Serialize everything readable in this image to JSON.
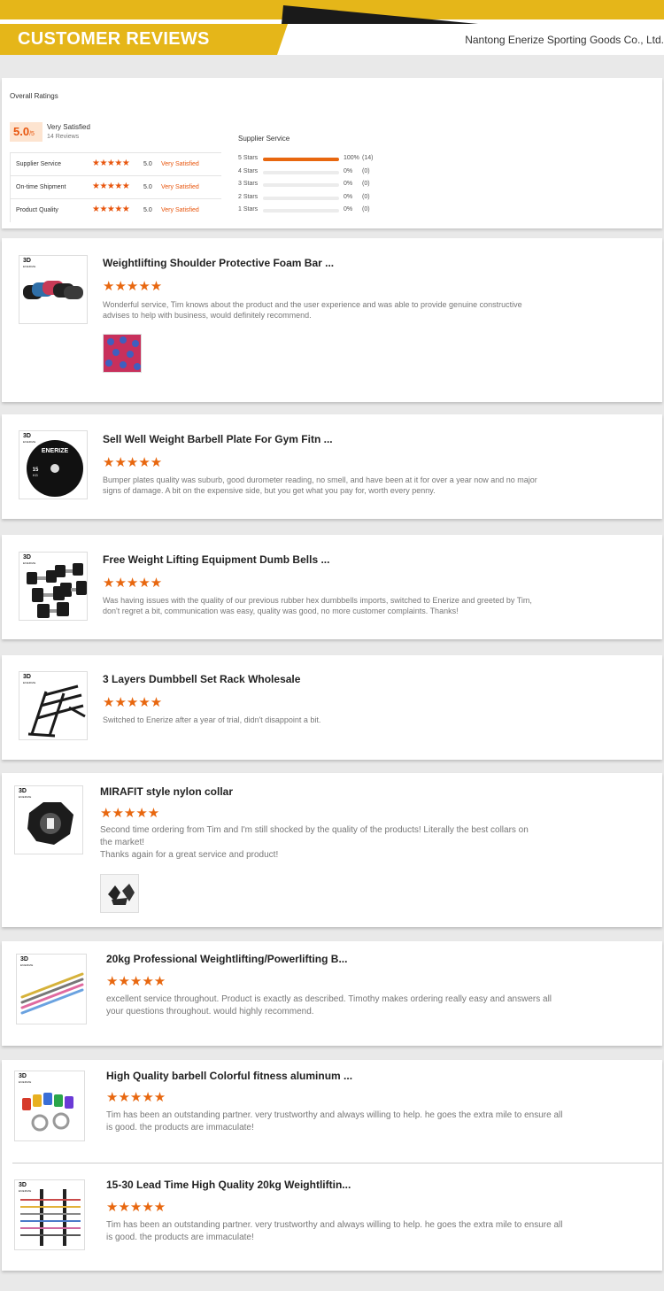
{
  "header": {
    "title": "CUSTOMER REVIEWS",
    "company": "Nantong Enerize Sporting Goods Co., Ltd."
  },
  "overall": {
    "title": "Overall Ratings",
    "score": "5.0",
    "score_suffix": "/5",
    "score_label": "Very Satisfied",
    "review_count": "14 Reviews",
    "categories": [
      {
        "label": "Supplier Service",
        "value": "5.0",
        "text": "Very Satisfied"
      },
      {
        "label": "On-time Shipment",
        "value": "5.0",
        "text": "Very Satisfied"
      },
      {
        "label": "Product Quality",
        "value": "5.0",
        "text": "Very Satisfied"
      }
    ],
    "distribution_title": "Supplier Service",
    "distribution": [
      {
        "label": "5 Stars",
        "percent": "100%",
        "count": "(14)",
        "fraction": 1.0
      },
      {
        "label": "4 Stars",
        "percent": "0%",
        "count": "(0)",
        "fraction": 0
      },
      {
        "label": "3 Stars",
        "percent": "0%",
        "count": "(0)",
        "fraction": 0
      },
      {
        "label": "2 Stars",
        "percent": "0%",
        "count": "(0)",
        "fraction": 0
      },
      {
        "label": "1 Stars",
        "percent": "0%",
        "count": "(0)",
        "fraction": 0
      }
    ]
  },
  "stars": "★★★★★",
  "logo": {
    "mark": "3D",
    "sub": "ENERIZE"
  },
  "reviews": [
    {
      "title": "Weightlifting Shoulder Protective Foam Bar ...",
      "text": "Wonderful service, Tim knows about the product and the user experience and was able to provide genuine constructive advises to help with business, would definitely recommend.",
      "product_icon": "foam-pad-icon"
    },
    {
      "title": "Sell Well Weight Barbell Plate For Gym Fitn  ...",
      "text": "Bumper plates quality was suburb, good durometer reading, no smell, and have been at it for over a year now and no major signs of damage. A bit on the expensive side, but you get what you pay for, worth every penny.",
      "product_icon": "bumper-plate-icon",
      "plate_brand": "ENERIZE",
      "plate_kg": "15",
      "plate_unit": "KG"
    },
    {
      "title": "Free Weight Lifting Equipment Dumb Bells  ...",
      "text": "Was having issues with the quality of our previous rubber hex dumbbells imports, switched to Enerize and greeted by Tim, don't regret a bit, communication was easy, quality was good, no more customer complaints. Thanks!",
      "product_icon": "dumbbells-icon"
    },
    {
      "title": "3 Layers Dumbbell Set Rack Wholesale",
      "text": "Switched to Enerize after a year of trial, didn't disappoint a bit.",
      "product_icon": "dumbbell-rack-icon"
    },
    {
      "title": "MIRAFIT style nylon collar",
      "text": "Second time ordering from Tim and I'm still shocked by the quality of the products! Literally the best collars on the market!",
      "text2": "Thanks again for a great service and product!",
      "product_icon": "nylon-collar-icon"
    },
    {
      "title": "20kg Professional Weightlifting/Powerlifting B...",
      "text": "excellent service throughout. Product is exactly as described. Timothy makes ordering really easy and answers all your questions throughout. would highly recommend.",
      "product_icon": "barbell-icon"
    },
    {
      "title": "High Quality barbell Colorful fitness aluminum  ...",
      "text": "Tim has been an outstanding partner. very trustworthy and always willing to help. he goes the extra mile to ensure all is good. the products are immaculate!",
      "product_icon": "colorful-collars-icon"
    },
    {
      "title": "15-30 Lead Time High Quality 20kg Weightliftin...",
      "text": "Tim has been an outstanding partner. very trustworthy and always willing to help. he goes the extra mile to ensure all is good. the products are immaculate!",
      "product_icon": "barbell-rack-icon"
    }
  ],
  "colors": {
    "accent": "#e8670f",
    "brand_yellow": "#e5b619",
    "header_dark": "#1a1a1a"
  }
}
